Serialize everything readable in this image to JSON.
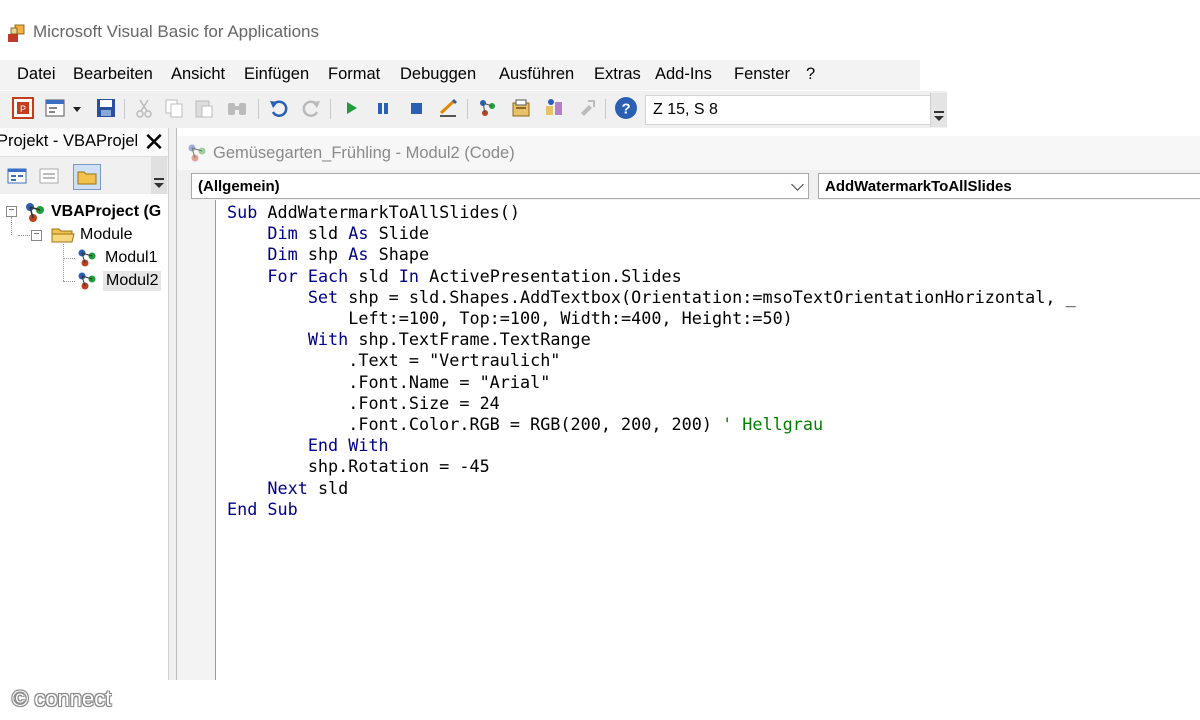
{
  "window": {
    "title": "Microsoft Visual Basic for Applications"
  },
  "menu": [
    "Datei",
    "Bearbeiten",
    "Ansicht",
    "Einfügen",
    "Format",
    "Debuggen",
    "Ausführen",
    "Extras",
    "Add-Ins",
    "Fenster",
    "?"
  ],
  "toolbar": {
    "status": "Z 15, S 8"
  },
  "project_panel": {
    "title": "Projekt - VBAProjekt",
    "tree": {
      "root": "VBAProject (G",
      "folder": "Module",
      "items": [
        "Modul1",
        "Modul2"
      ]
    }
  },
  "code_window": {
    "title": "Gemüsegarten_Frühling - Modul2 (Code)",
    "object_combo": "(Allgemein)",
    "procedure_combo": "AddWatermarkToAllSlides",
    "lines": [
      "Sub AddWatermarkToAllSlides()",
      "    Dim sld As Slide",
      "    Dim shp As Shape",
      "    For Each sld In ActivePresentation.Slides",
      "        Set shp = sld.Shapes.AddTextbox(Orientation:=msoTextOrientationHorizontal, _",
      "            Left:=100, Top:=100, Width:=400, Height:=50)",
      "        With shp.TextFrame.TextRange",
      "            .Text = \"Vertraulich\"",
      "            .Font.Name = \"Arial\"",
      "            .Font.Size = 24",
      "            .Font.Color.RGB = RGB(200, 200, 200) ' Hellgrau",
      "        End With",
      "        shp.Rotation = -45",
      "    Next sld",
      "End Sub"
    ]
  },
  "watermark": "© connect"
}
